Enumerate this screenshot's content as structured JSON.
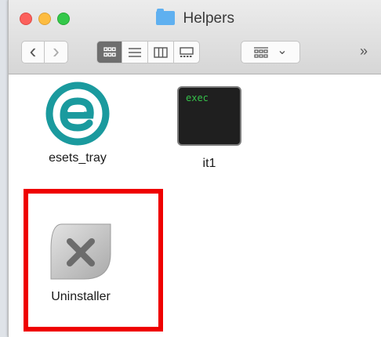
{
  "window": {
    "title": "Helpers"
  },
  "toolbar": {
    "back_label": "‹",
    "forward_label": "›",
    "more_label": "»",
    "arrange_caret": "⌄"
  },
  "files": [
    {
      "name": "esets_tray",
      "icon": "eset-app-icon"
    },
    {
      "name": "it1",
      "icon": "terminal-exec-icon",
      "icon_text": "exec"
    },
    {
      "name": "Uninstaller",
      "icon": "uninstaller-icon"
    }
  ],
  "colors": {
    "eset_teal": "#1a9a9e",
    "highlight_red": "#ef0000",
    "terminal_green": "#35c04a"
  }
}
